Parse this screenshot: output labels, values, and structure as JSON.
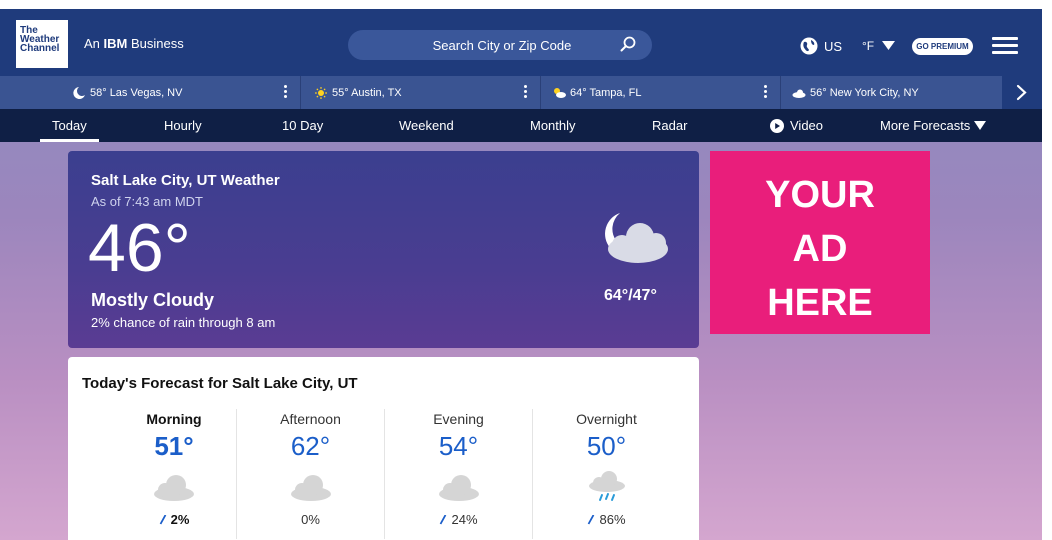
{
  "header": {
    "logo_lines": [
      "The",
      "Weather",
      "Channel"
    ],
    "tagline_prefix": "An ",
    "tagline_brand": "IBM",
    "tagline_suffix": " Business",
    "search_placeholder": "Search City or Zip Code",
    "locale": "US",
    "unit": "°F",
    "premium_label": "GO PREMIUM"
  },
  "recent_locations": [
    {
      "text": "58° Las Vegas, NV",
      "icon": "moon-icon"
    },
    {
      "text": "55° Austin, TX",
      "icon": "sun-icon"
    },
    {
      "text": "64° Tampa, FL",
      "icon": "partly-cloudy-icon"
    },
    {
      "text": "56° New York City, NY",
      "icon": "cloud-icon"
    }
  ],
  "nav": {
    "items": [
      "Today",
      "Hourly",
      "10 Day",
      "Weekend",
      "Monthly",
      "Radar",
      "Video",
      "More Forecasts"
    ],
    "active": "Today"
  },
  "current": {
    "title": "Salt Lake City, UT Weather",
    "as_of": "As of 7:43 am MDT",
    "temp": "46°",
    "phrase": "Mostly Cloudy",
    "rain": "2% chance of rain through 8 am",
    "hilo": "64°/47°",
    "icon": "mostly-cloudy-night-icon"
  },
  "ad": {
    "lines": [
      "YOUR",
      "AD",
      "HERE"
    ]
  },
  "today_forecast": {
    "title": "Today's Forecast for Salt Lake City, UT",
    "periods": [
      {
        "label": "Morning",
        "temp": "51°",
        "precip": "2%",
        "icon": "cloud-icon"
      },
      {
        "label": "Afternoon",
        "temp": "62°",
        "precip": "0%",
        "icon": "cloud-icon"
      },
      {
        "label": "Evening",
        "temp": "54°",
        "precip": "24%",
        "icon": "cloud-icon"
      },
      {
        "label": "Overnight",
        "temp": "50°",
        "precip": "86%",
        "icon": "rain-icon"
      }
    ]
  },
  "colors": {
    "header_bg": "#1f3b7c",
    "locbar_bg": "#3a5492",
    "nav_bg": "#0f1f45",
    "ad_bg": "#e91e7b",
    "temp_blue": "#1b5ec9"
  }
}
